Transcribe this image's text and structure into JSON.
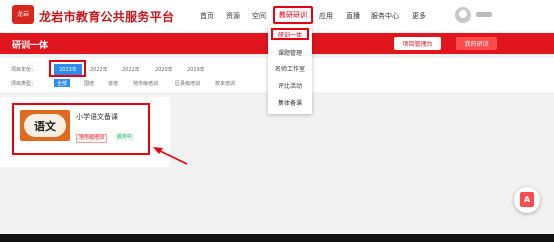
{
  "header": {
    "logo_text": "龙岩",
    "site_title": "龙岩市教育公共服务平台",
    "nav": [
      "首页",
      "资源",
      "空间",
      "教研研训",
      "应用",
      "直播",
      "服务中心",
      "更多"
    ],
    "active_nav": "教研研训",
    "dropdown": [
      "研训一体",
      "课题管理",
      "名师工作室",
      "评比活动",
      "集体备课"
    ]
  },
  "page": {
    "title": "研训一体",
    "project_button": "项目管理台",
    "my_button": "我的研训"
  },
  "filters": {
    "year_label": "项目年份：",
    "years": [
      "2023年",
      "2022年",
      "2021年",
      "2020年",
      "2019年"
    ],
    "type_label": "项目类型：",
    "types": [
      "全部",
      "国培",
      "省培",
      "地市级培训",
      "区县级培训",
      "校本培训"
    ]
  },
  "card": {
    "thumb_text": "语文",
    "title": "小学语文备课",
    "level_tag": "地市级培训",
    "status_tag": "服务中"
  },
  "float_button": {
    "icon_text": "A"
  },
  "colors": {
    "accent": "#e0151d",
    "selected": "#2d8cf0",
    "status_green": "#19be6b"
  }
}
